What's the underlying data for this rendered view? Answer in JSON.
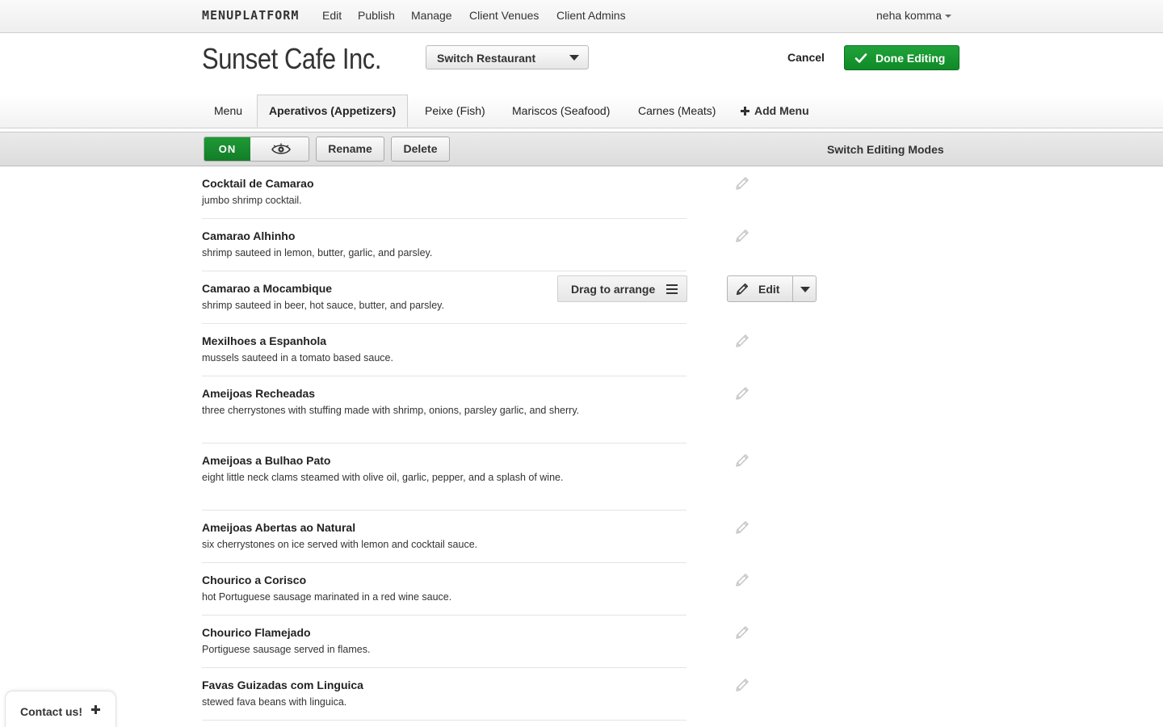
{
  "topnav": {
    "brand": "MENUPLATFORM",
    "links": [
      "Edit",
      "Publish",
      "Manage",
      "Client Venues",
      "Client Admins"
    ],
    "user": "neha komma"
  },
  "header": {
    "restaurant_name": "Sunset Cafe Inc.",
    "switch_restaurant": "Switch Restaurant",
    "cancel": "Cancel",
    "done_editing": "Done Editing"
  },
  "tabs": {
    "items": [
      "Menu",
      "Aperativos (Appetizers)",
      "Peixe (Fish)",
      "Mariscos (Seafood)",
      "Carnes (Meats)"
    ],
    "active": "Aperativos (Appetizers)",
    "add_menu": "Add Menu"
  },
  "modebar": {
    "toggle_on": "ON",
    "rename": "Rename",
    "delete": "Delete",
    "switch_modes": "Switch Editing Modes"
  },
  "items": [
    {
      "name": "Cocktail de Camarao",
      "desc": "jumbo shrimp cocktail."
    },
    {
      "name": "Camarao Alhinho",
      "desc": "shrimp sauteed in lemon, butter, garlic, and parsley."
    },
    {
      "name": "Camarao a Mocambique",
      "desc": "shrimp sauteed in beer, hot sauce, butter, and parsley."
    },
    {
      "name": "Mexilhoes a Espanhola",
      "desc": "mussels sauteed in a tomato based sauce."
    },
    {
      "name": "Ameijoas Recheadas",
      "desc": "three cherrystones with stuffing made with shrimp, onions, parsley garlic, and sherry."
    },
    {
      "name": "Ameijoas a Bulhao Pato",
      "desc": "eight little neck clams steamed with olive oil, garlic, pepper, and a splash of wine."
    },
    {
      "name": "Ameijoas Abertas ao Natural",
      "desc": "six cherrystones on ice served with lemon and cocktail sauce."
    },
    {
      "name": "Chourico a Corisco",
      "desc": "hot Portuguese sausage marinated in a red wine sauce."
    },
    {
      "name": "Chourico Flamejado",
      "desc": "Portiguese sausage served in flames."
    },
    {
      "name": "Favas Guizadas com Linguica",
      "desc": "stewed fava beans with linguica."
    }
  ],
  "hover_item": {
    "drag_label": "Drag to arrange",
    "edit_label": "Edit"
  },
  "contact": {
    "label": "Contact us!"
  },
  "colors": {
    "accent_green": "#139230"
  }
}
